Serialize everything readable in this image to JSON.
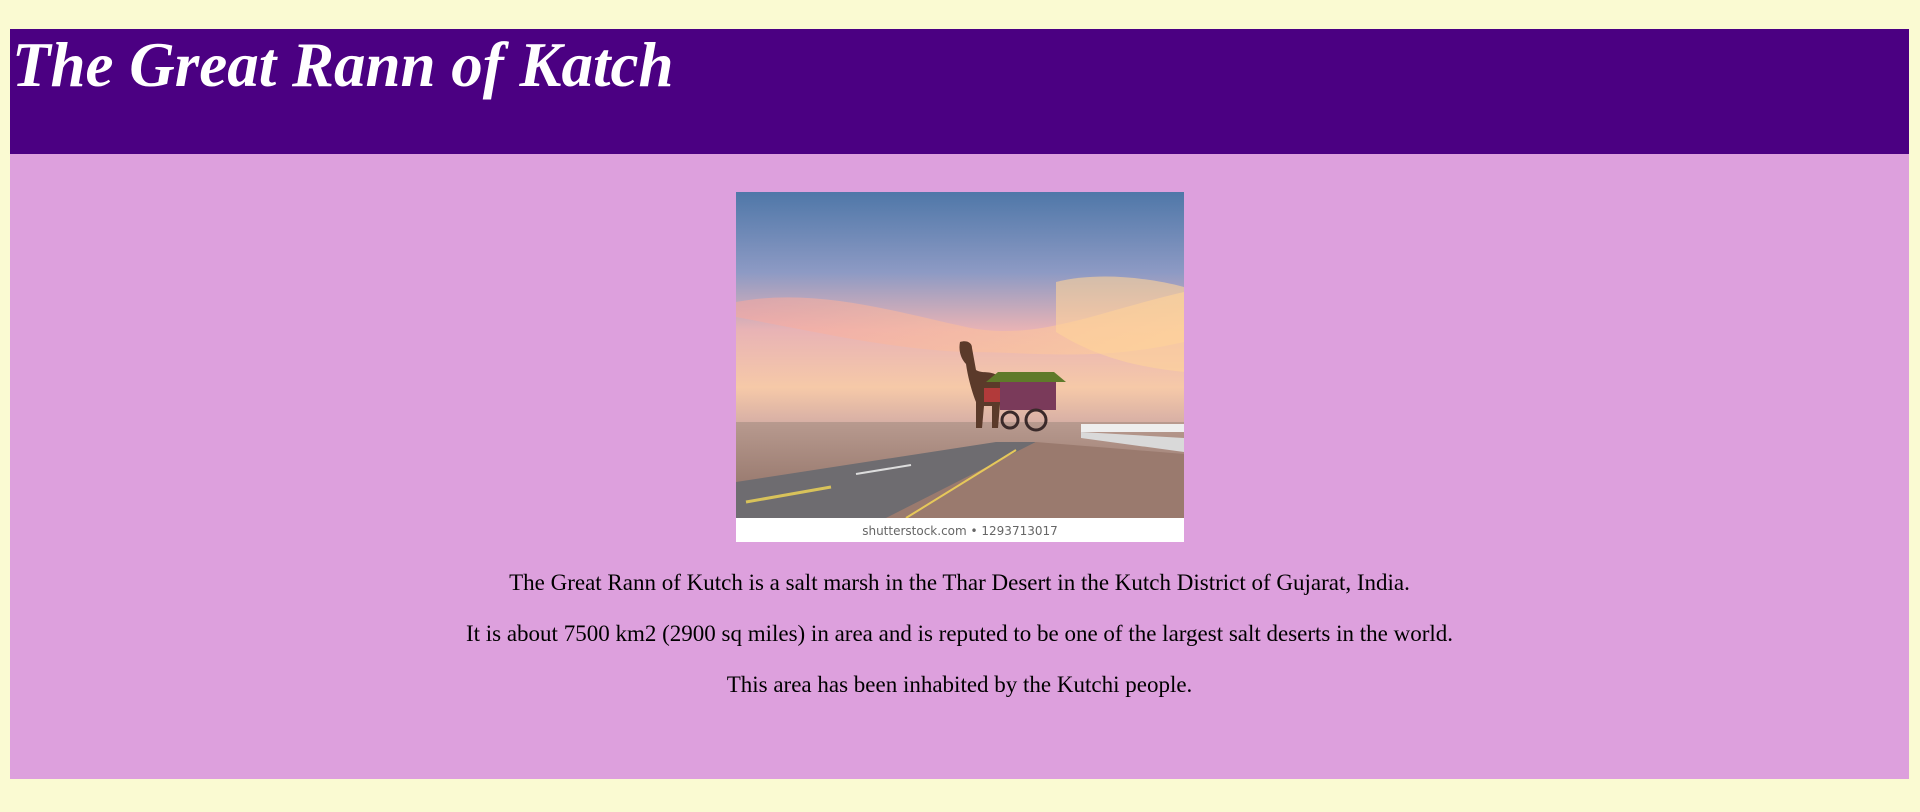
{
  "header": {
    "title": "The Great Rann of Katch"
  },
  "image": {
    "watermark": "shutterstock.com • 1293713017",
    "subject_icon": "camel-cart-photo"
  },
  "paragraphs": [
    "The Great Rann of Kutch is a salt marsh in the Thar Desert in the Kutch District of Gujarat, India.",
    "It is about 7500 km2 (2900 sq miles) in area and is reputed to be one of the largest salt deserts in the world.",
    "This area has been inhabited by the Kutchi people."
  ],
  "colors": {
    "page_background": "#fafad2",
    "header_background": "#4b0082",
    "header_text": "#ffffff",
    "content_background": "#dda0dd",
    "content_text": "#000000"
  }
}
